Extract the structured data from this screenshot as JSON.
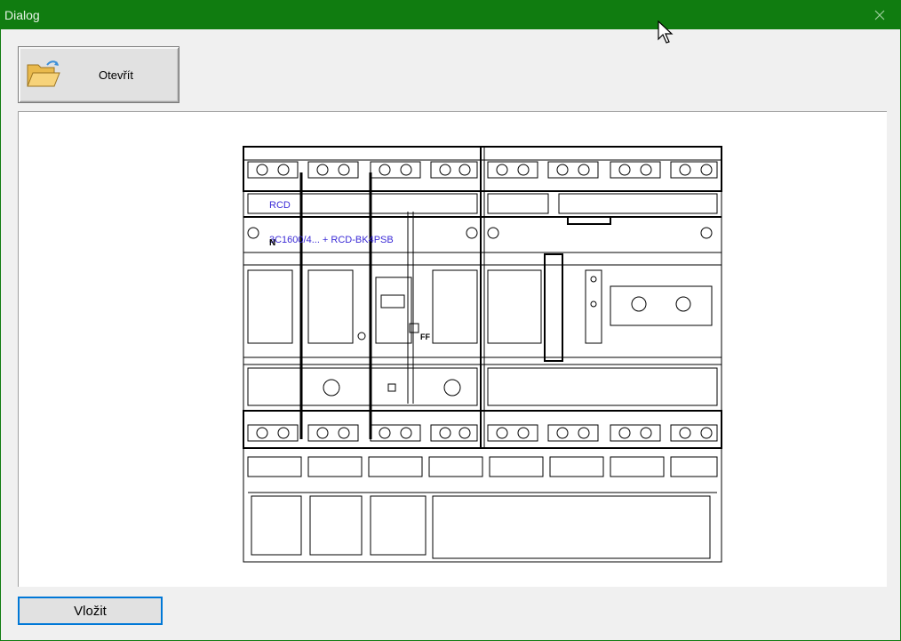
{
  "window": {
    "title": "Dialog"
  },
  "toolbar": {
    "open_label": "Otevřít"
  },
  "preview": {
    "labels": {
      "rcd": "RCD",
      "part": "3C1600/4... + RCD-BK4PSB",
      "n": "N",
      "ff": "FF"
    }
  },
  "actions": {
    "insert_label": "Vložit"
  },
  "colors": {
    "titlebar": "#107c10",
    "focus": "#0078d7",
    "drawing_label": "#3a2ad6"
  }
}
